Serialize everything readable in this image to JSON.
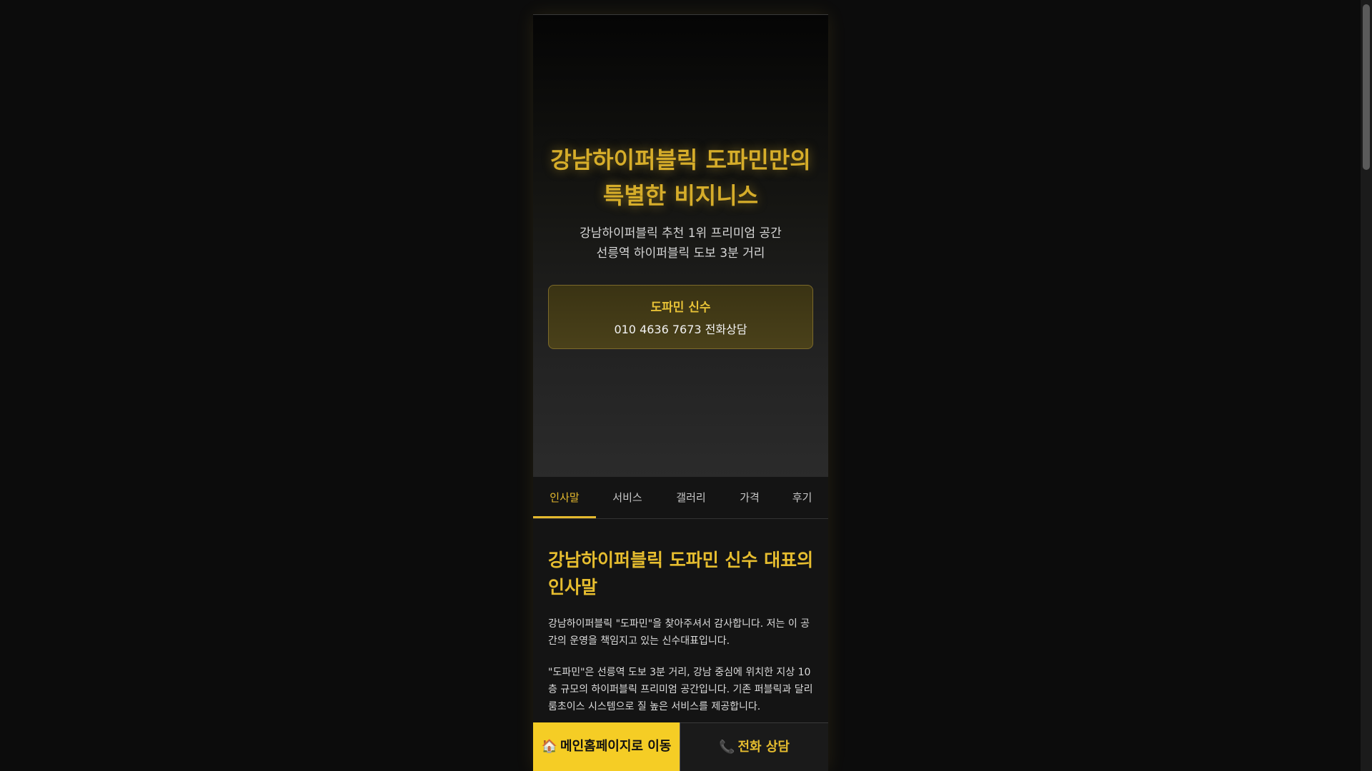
{
  "hero": {
    "title": "강남하이퍼블릭 도파민만의 특별한 비지니스",
    "subtitle_line1": "강남하이퍼블릭 추천 1위 프리미엄 공간",
    "subtitle_line2": "선릉역 하이퍼블릭 도보 3분 거리"
  },
  "contact": {
    "name": "도파민 신수",
    "phone": "010 4636 7673 전화상담"
  },
  "tabs": [
    {
      "label": "인사말",
      "active": true
    },
    {
      "label": "서비스",
      "active": false
    },
    {
      "label": "갤러리",
      "active": false
    },
    {
      "label": "가격",
      "active": false
    },
    {
      "label": "후기",
      "active": false
    }
  ],
  "content": {
    "heading": "강남하이퍼블릭 도파민 신수 대표의 인사말",
    "paragraph1": "강남하이퍼블릭 \"도파민\"을 찾아주셔서 감사합니다. 저는 이 공간의 운영을 책임지고 있는 신수대표입니다.",
    "paragraph2": "\"도파민\"은 선릉역 도보 3분 거리, 강남 중심에 위치한 지상 10층 규모의 하이퍼블릭 프리미엄 공간입니다. 기존 퍼블릭과 달리 룸초이스 시스템으로 질 높은 서비스를 제공합니다."
  },
  "bottom_bar": {
    "home_icon": "🏠",
    "home_label": "메인홈페이지로 이동",
    "call_icon": "📞",
    "call_label": "전화 상담"
  },
  "colors": {
    "accent": "#e6bd2f",
    "home_button_bg": "#f5cd25",
    "background": "#0c0c0c"
  }
}
